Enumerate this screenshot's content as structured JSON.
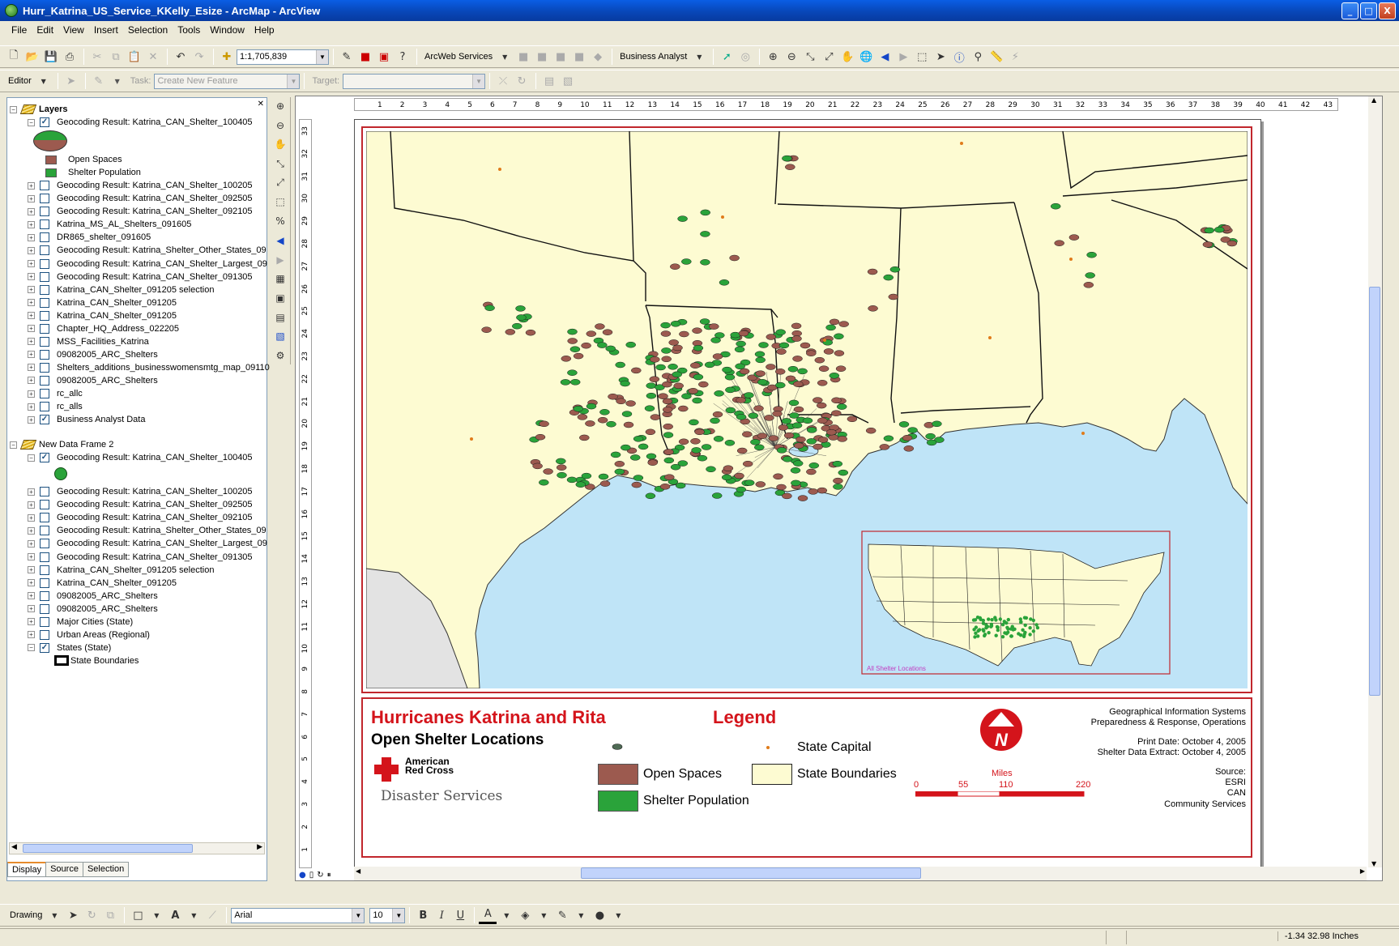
{
  "window": {
    "title": "Hurr_Katrina_US_Service_KKelly_Esize - ArcMap - ArcView",
    "controls": [
      "_",
      "□",
      "X"
    ]
  },
  "menu": [
    "File",
    "Edit",
    "View",
    "Insert",
    "Selection",
    "Tools",
    "Window",
    "Help"
  ],
  "toolbar1": {
    "scale": "1:1,705,839",
    "arcweb_label": "ArcWeb Services",
    "business_label": "Business Analyst"
  },
  "toolbar2": {
    "editor_label": "Editor",
    "task_label": "Task:",
    "task_value": "Create New Feature",
    "target_label": "Target:",
    "target_value": ""
  },
  "toc": {
    "frame1": {
      "name": "Layers",
      "expanded_layer": "Geocoding Result: Katrina_CAN_Shelter_100405",
      "legend_items": [
        "Open Spaces",
        "Shelter Population"
      ],
      "layers": [
        {
          "name": "Geocoding Result: Katrina_CAN_Shelter_100205",
          "checked": false
        },
        {
          "name": "Geocoding Result: Katrina_CAN_Shelter_092505",
          "checked": false
        },
        {
          "name": "Geocoding Result: Katrina_CAN_Shelter_092105",
          "checked": false
        },
        {
          "name": "Katrina_MS_AL_Shelters_091605",
          "checked": false
        },
        {
          "name": "DR865_shelter_091605",
          "checked": false
        },
        {
          "name": "Geocoding Result: Katrina_Shelter_Other_States_09",
          "checked": false
        },
        {
          "name": "Geocoding Result: Katrina_CAN_Shelter_Largest_09",
          "checked": false
        },
        {
          "name": "Geocoding Result: Katrina_CAN_Shelter_091305",
          "checked": false
        },
        {
          "name": "Katrina_CAN_Shelter_091205 selection",
          "checked": false
        },
        {
          "name": "Katrina_CAN_Shelter_091205",
          "checked": false
        },
        {
          "name": "Katrina_CAN_Shelter_091205",
          "checked": false
        },
        {
          "name": "Chapter_HQ_Address_022205",
          "checked": false
        },
        {
          "name": "MSS_Facilities_Katrina",
          "checked": false
        },
        {
          "name": "09082005_ARC_Shelters",
          "checked": false
        },
        {
          "name": "Shelters_additions_businesswomensmtg_map_09110",
          "checked": false
        },
        {
          "name": "09082005_ARC_Shelters",
          "checked": false
        },
        {
          "name": "rc_allc",
          "checked": false
        },
        {
          "name": "rc_alls",
          "checked": false
        },
        {
          "name": "Business Analyst Data",
          "checked": true
        }
      ]
    },
    "frame2": {
      "name": "New Data Frame 2",
      "expanded_layer": "Geocoding Result: Katrina_CAN_Shelter_100405",
      "layers": [
        {
          "name": "Geocoding Result: Katrina_CAN_Shelter_100205",
          "checked": false
        },
        {
          "name": "Geocoding Result: Katrina_CAN_Shelter_092505",
          "checked": false
        },
        {
          "name": "Geocoding Result: Katrina_CAN_Shelter_092105",
          "checked": false
        },
        {
          "name": "Geocoding Result: Katrina_Shelter_Other_States_09",
          "checked": false
        },
        {
          "name": "Geocoding Result: Katrina_CAN_Shelter_Largest_09",
          "checked": false
        },
        {
          "name": "Geocoding Result: Katrina_CAN_Shelter_091305",
          "checked": false
        },
        {
          "name": "Katrina_CAN_Shelter_091205 selection",
          "checked": false
        },
        {
          "name": "Katrina_CAN_Shelter_091205",
          "checked": false
        },
        {
          "name": "09082005_ARC_Shelters",
          "checked": false
        },
        {
          "name": "09082005_ARC_Shelters",
          "checked": false
        },
        {
          "name": "Major Cities (State)",
          "checked": false
        },
        {
          "name": "Urban Areas (Regional)",
          "checked": false
        }
      ],
      "last_layer": "States (State)",
      "last_layer_legend": "State Boundaries"
    },
    "tabs": [
      "Display",
      "Source",
      "Selection"
    ]
  },
  "rulers": {
    "h_ticks": [
      "1",
      "2",
      "3",
      "4",
      "5",
      "6",
      "7",
      "8",
      "9",
      "10",
      "11",
      "12",
      "13",
      "14",
      "15",
      "16",
      "17",
      "18",
      "19",
      "20",
      "21",
      "22",
      "23",
      "24",
      "25",
      "26",
      "27",
      "28",
      "29",
      "30",
      "31",
      "32",
      "33",
      "34",
      "35",
      "36",
      "37",
      "38",
      "39",
      "40",
      "41",
      "42",
      "43"
    ],
    "v_ticks": [
      "33",
      "32",
      "31",
      "30",
      "29",
      "28",
      "27",
      "26",
      "25",
      "24",
      "23",
      "22",
      "21",
      "20",
      "19",
      "18",
      "17",
      "16",
      "15",
      "14",
      "13",
      "12",
      "11",
      "10",
      "9",
      "8",
      "7",
      "6",
      "5",
      "4",
      "3",
      "2",
      "1"
    ]
  },
  "map": {
    "inset_label": "All Shelter Locations",
    "colors": {
      "water": "#bfe4f7",
      "land": "#fdfbd2",
      "open": "#9c5a4f",
      "shelter": "#2aa33a",
      "frame": "#c1272d"
    }
  },
  "legend": {
    "title": "Hurricanes Katrina and Rita",
    "subtitle": "Open Shelter Locations",
    "org_line1": "American",
    "org_line2": "Red Cross",
    "services": "Disaster Services",
    "heading": "Legend",
    "items": {
      "open": "Open Spaces",
      "shelter": "Shelter Population",
      "capital": "State Capital",
      "boundaries": "State Boundaries"
    },
    "north": "N",
    "info_line1": "Geographical Information Systems",
    "info_line2": "Preparedness & Response, Operations",
    "print_date": "Print Date: October 4, 2005",
    "extract_date": "Shelter Data Extract: October 4, 2005",
    "source_label": "Source:",
    "sources": [
      "ESRI",
      "CAN",
      "Community Services"
    ],
    "scale_unit": "Miles",
    "scale_ticks": [
      "0",
      "55",
      "110",
      "220"
    ]
  },
  "drawbar": {
    "drawing_label": "Drawing",
    "font": "Arial",
    "size": "10"
  },
  "status": {
    "coords": "-1.34  32.98 Inches"
  }
}
